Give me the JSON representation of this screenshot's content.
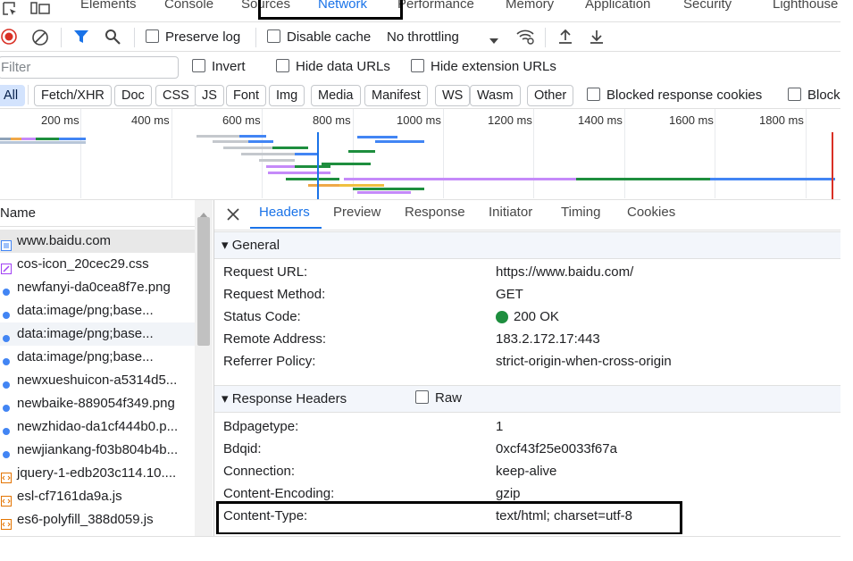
{
  "main_tabs": [
    "Elements",
    "Console",
    "Sources",
    "Network",
    "Performance",
    "Memory",
    "Application",
    "Security",
    "Lighthouse"
  ],
  "toolbar": {
    "preserve_log": "Preserve log",
    "disable_cache": "Disable cache",
    "throttling": "No throttling"
  },
  "filter_bar": {
    "placeholder": "Filter",
    "invert": "Invert",
    "hide_data_urls": "Hide data URLs",
    "hide_extension_urls": "Hide extension URLs"
  },
  "type_filters": [
    "All",
    "Fetch/XHR",
    "Doc",
    "CSS",
    "JS",
    "Font",
    "Img",
    "Media",
    "Manifest",
    "WS",
    "Wasm",
    "Other"
  ],
  "blocked_response_cookies": "Blocked response cookies",
  "blocked_requests_partial": "Block",
  "overview_ticks": [
    "200 ms",
    "400 ms",
    "600 ms",
    "800 ms",
    "1000 ms",
    "1200 ms",
    "1400 ms",
    "1600 ms",
    "1800 ms"
  ],
  "name_header": "Name",
  "requests": [
    {
      "name": "www.baidu.com",
      "icon": "document-icon"
    },
    {
      "name": "cos-icon_20cec29.css",
      "icon": "stylesheet-icon"
    },
    {
      "name": "newfanyi-da0cea8f7e.png",
      "icon": "image-icon"
    },
    {
      "name": "data:image/png;base...",
      "icon": "image-icon"
    },
    {
      "name": "data:image/png;base...",
      "icon": "image-icon"
    },
    {
      "name": "data:image/png;base...",
      "icon": "image-icon"
    },
    {
      "name": "newxueshuicon-a5314d5...",
      "icon": "image-icon"
    },
    {
      "name": "newbaike-889054f349.png",
      "icon": "image-icon"
    },
    {
      "name": "newzhidao-da1cf444b0.p...",
      "icon": "image-icon"
    },
    {
      "name": "newjiankang-f03b804b4b...",
      "icon": "image-icon"
    },
    {
      "name": "jquery-1-edb203c114.10....",
      "icon": "script-icon"
    },
    {
      "name": "esl-cf7161da9a.js",
      "icon": "script-icon"
    },
    {
      "name": "es6-polyfill_388d059.js",
      "icon": "script-icon"
    }
  ],
  "detail_tabs": [
    "Headers",
    "Preview",
    "Response",
    "Initiator",
    "Timing",
    "Cookies"
  ],
  "general": {
    "title": "General",
    "rows": [
      {
        "k": "Request URL:",
        "v": "https://www.baidu.com/"
      },
      {
        "k": "Request Method:",
        "v": "GET"
      },
      {
        "k": "Status Code:",
        "v": "200 OK"
      },
      {
        "k": "Remote Address:",
        "v": "183.2.172.17:443"
      },
      {
        "k": "Referrer Policy:",
        "v": "strict-origin-when-cross-origin"
      }
    ]
  },
  "response_headers": {
    "title": "Response Headers",
    "raw_label": "Raw",
    "rows": [
      {
        "k": "Bdpagetype:",
        "v": "1"
      },
      {
        "k": "Bdqid:",
        "v": "0xcf43f25e0033f67a"
      },
      {
        "k": "Connection:",
        "v": "keep-alive"
      },
      {
        "k": "Content-Encoding:",
        "v": "gzip"
      },
      {
        "k": "Content-Type:",
        "v": "text/html; charset=utf-8"
      }
    ]
  },
  "colors": {
    "accent": "#1a73e8",
    "status_ok": "#1e8e3e",
    "record_red": "#d93025"
  }
}
